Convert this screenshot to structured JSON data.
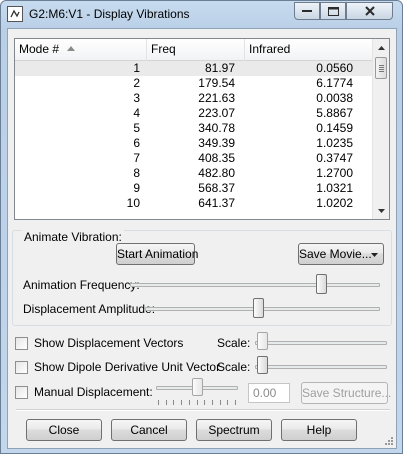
{
  "window": {
    "title": "G2:M6:V1 - Display Vibrations",
    "min_icon": "minimize-icon",
    "max_icon": "maximize-icon",
    "close_icon": "close-icon"
  },
  "list": {
    "headers": {
      "mode": "Mode #",
      "freq": "Freq",
      "infrared": "Infrared"
    },
    "rows": [
      {
        "mode": "1",
        "freq": "81.97",
        "infrared": "0.0560"
      },
      {
        "mode": "2",
        "freq": "179.54",
        "infrared": "6.1774"
      },
      {
        "mode": "3",
        "freq": "221.63",
        "infrared": "0.0038"
      },
      {
        "mode": "4",
        "freq": "223.07",
        "infrared": "5.8867"
      },
      {
        "mode": "5",
        "freq": "340.78",
        "infrared": "0.1459"
      },
      {
        "mode": "6",
        "freq": "349.39",
        "infrared": "1.0235"
      },
      {
        "mode": "7",
        "freq": "408.35",
        "infrared": "0.3747"
      },
      {
        "mode": "8",
        "freq": "482.80",
        "infrared": "1.2700"
      },
      {
        "mode": "9",
        "freq": "568.37",
        "infrared": "1.0321"
      },
      {
        "mode": "10",
        "freq": "641.37",
        "infrared": "1.0202"
      }
    ],
    "selected_row": 0
  },
  "animate": {
    "group_label": "Animate Vibration:",
    "start_button": "Start Animation",
    "save_movie_button": "Save Movie...",
    "frequency_label": "Animation Frequency:",
    "frequency_value": 0.78,
    "amplitude_label": "Displacement Amplitude:",
    "amplitude_value": 0.48
  },
  "options": {
    "show_vectors": {
      "label": "Show Displacement Vectors",
      "checked": false,
      "scale_label": "Scale:",
      "scale_value": 0.02
    },
    "show_dipole": {
      "label": "Show Dipole Derivative Unit Vector",
      "checked": false,
      "scale_label": "Scale:",
      "scale_value": 0.02
    },
    "manual": {
      "label": "Manual Displacement:",
      "checked": false,
      "value": "0.00",
      "slider_value": 0.5,
      "save_structure_button": "Save Structure..."
    }
  },
  "buttons": {
    "close": "Close",
    "cancel": "Cancel",
    "spectrum": "Spectrum",
    "help": "Help"
  }
}
